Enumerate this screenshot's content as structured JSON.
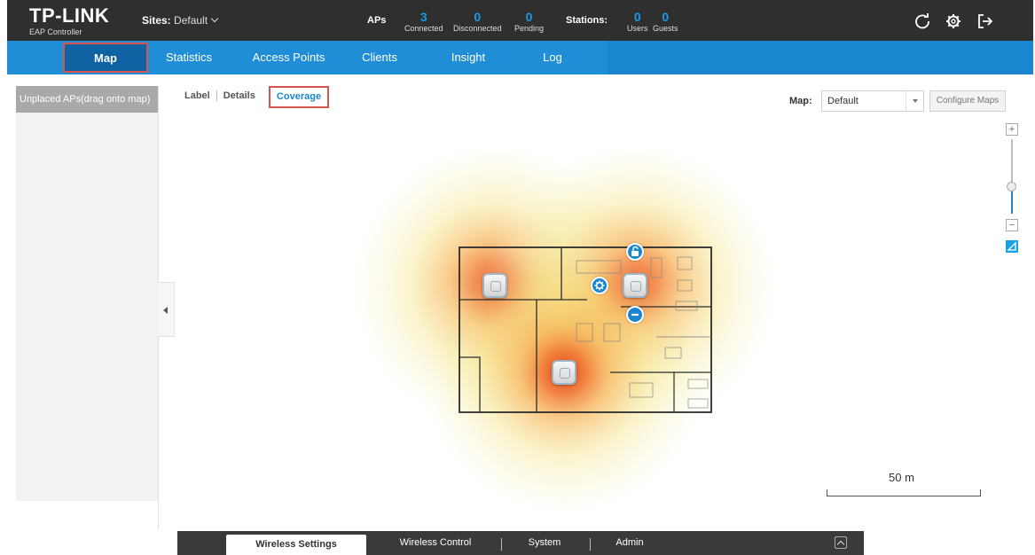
{
  "header": {
    "logo": "TP-LINK",
    "product": "EAP Controller",
    "sites_label": "Sites:",
    "sites_value": "Default",
    "aps_label": "APs",
    "aps": [
      {
        "value": "3",
        "label": "Connected"
      },
      {
        "value": "0",
        "label": "Disconnected"
      },
      {
        "value": "0",
        "label": "Pending"
      }
    ],
    "stations_label": "Stations:",
    "stations": [
      {
        "value": "0",
        "label": "Users"
      },
      {
        "value": "0",
        "label": "Guests"
      }
    ],
    "icons": [
      "refresh-icon",
      "gear-icon",
      "logout-icon"
    ]
  },
  "nav": {
    "tabs": [
      "Map",
      "Statistics",
      "Access Points",
      "Clients",
      "Insight",
      "Log"
    ],
    "active": "Map"
  },
  "left_panel": {
    "title": "Unplaced APs(drag onto map)"
  },
  "views": {
    "label": "Label",
    "details": "Details",
    "coverage": "Coverage",
    "active": "Coverage"
  },
  "map_select": {
    "label": "Map:",
    "value": "Default",
    "configure": "Configure Maps"
  },
  "zoom": {
    "plus": "+",
    "minus": "−",
    "level": 0.37
  },
  "scale": {
    "label": "50 m"
  },
  "bottom_bar": {
    "tabs": [
      "Wireless Settings",
      "Wireless Control",
      "System",
      "Admin"
    ],
    "active": "Wireless Settings"
  },
  "colors": {
    "header_bg": "#2f2f2f",
    "nav_bg": "#1f8ed6",
    "nav_active": "#0f63a3",
    "highlight": "#d9534f",
    "accent": "#1a86cf"
  }
}
